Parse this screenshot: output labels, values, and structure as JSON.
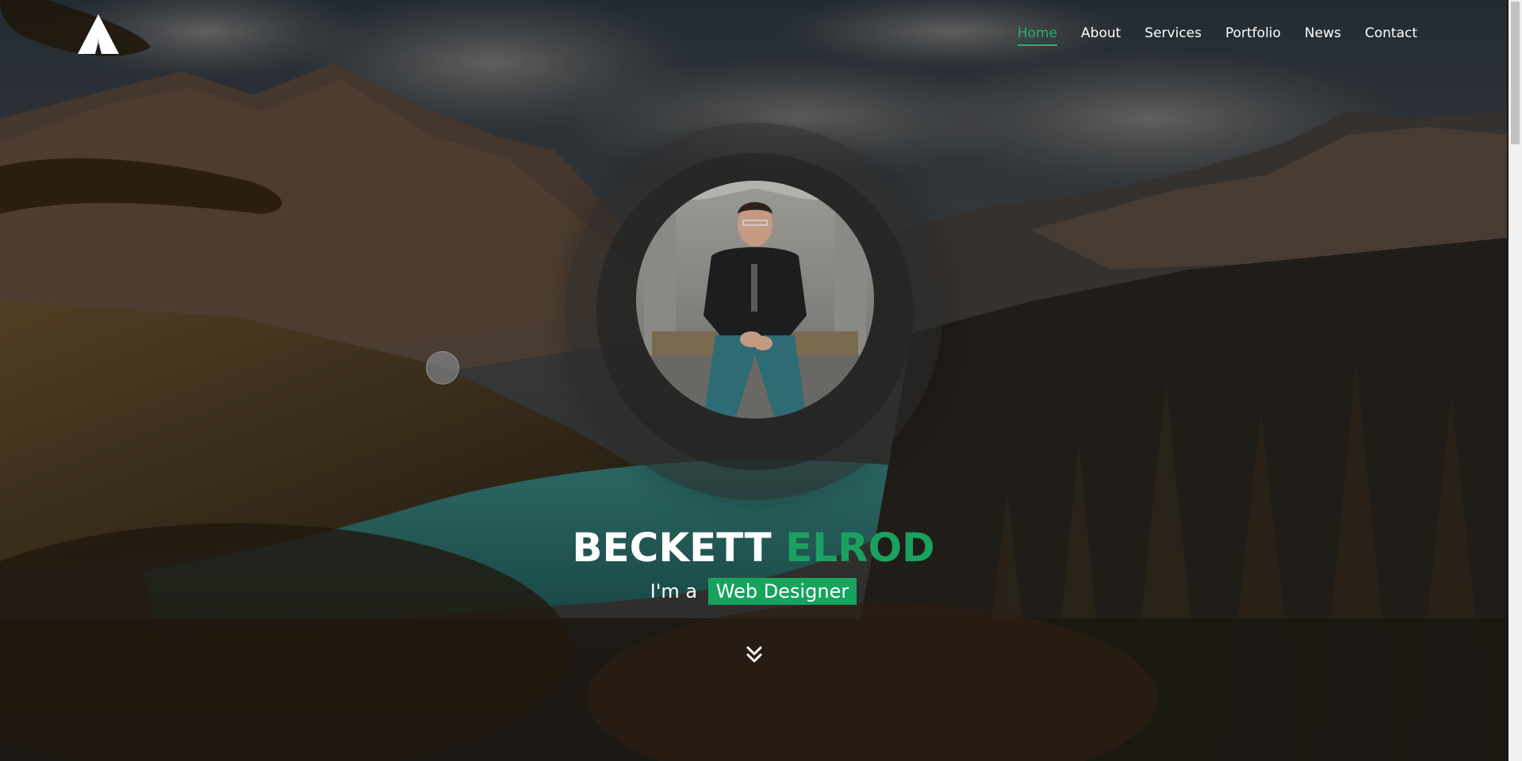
{
  "header": {
    "logo": "triangle-a-logo",
    "nav": [
      {
        "label": "Home",
        "active": true
      },
      {
        "label": "About",
        "active": false
      },
      {
        "label": "Services",
        "active": false
      },
      {
        "label": "Portfolio",
        "active": false
      },
      {
        "label": "News",
        "active": false
      },
      {
        "label": "Contact",
        "active": false
      }
    ]
  },
  "hero": {
    "first_name": "BECKETT",
    "last_name": "ELROD",
    "tagline_prefix": "I'm a",
    "role": "Web Designer",
    "scroll_icon": "double-chevron-down-icon"
  },
  "colors": {
    "accent": "#1aa15f",
    "text": "#ffffff"
  }
}
